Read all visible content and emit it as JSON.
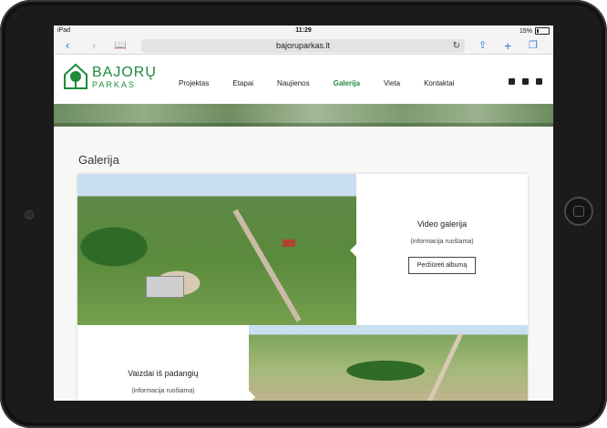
{
  "status_bar": {
    "device": "iPad",
    "time": "11:29",
    "battery": "15%"
  },
  "browser": {
    "url": "bajoruparkas.lt"
  },
  "site": {
    "logo_line1": "BAJORŲ",
    "logo_line2": "PARKAS",
    "nav": [
      "Projektas",
      "Etapai",
      "Naujienos",
      "Galerija",
      "Vieta",
      "Kontaktai"
    ],
    "active_nav": "Galerija",
    "social": [
      "facebook-icon",
      "phone-icon",
      "mail-icon"
    ]
  },
  "page": {
    "title": "Galerija",
    "albums": [
      {
        "title": "Video galerija",
        "subtitle": "(informacija ruošiama)",
        "button": "Peržiūrėti albumą"
      },
      {
        "title": "Vaizdai iš padangių",
        "subtitle": "(informacija ruošiama)"
      }
    ]
  },
  "colors": {
    "brand": "#1e8a3c",
    "link": "#2a7ce0"
  }
}
